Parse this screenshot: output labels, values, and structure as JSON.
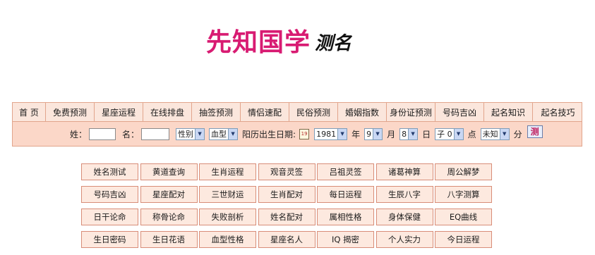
{
  "logo": {
    "main": "先知国学",
    "sub": "测名"
  },
  "nav": {
    "items": [
      {
        "label": "首 页"
      },
      {
        "label": "免费预测"
      },
      {
        "label": "星座运程"
      },
      {
        "label": "在线排盘"
      },
      {
        "label": "抽签预测"
      },
      {
        "label": "情侣速配"
      },
      {
        "label": "民俗预测"
      },
      {
        "label": "婚姻指数"
      },
      {
        "label": "身份证预测"
      },
      {
        "label": "号码吉凶"
      },
      {
        "label": "起名知识"
      },
      {
        "label": "起名技巧"
      }
    ]
  },
  "form": {
    "surname_label": "姓：",
    "name_label": "名：",
    "gender_value": "性别",
    "blood_value": "血型",
    "birth_label": "阳历出生日期:",
    "calendar_text": "19",
    "year_value": "1981",
    "year_unit": "年",
    "month_value": "9",
    "month_unit": "月",
    "day_value": "8",
    "day_unit": "日",
    "hour_value": "子 0",
    "hour_unit": "点",
    "minute_value": "未知",
    "minute_unit": "分",
    "submit_label": "测"
  },
  "grid": {
    "rows": [
      [
        "姓名测试",
        "黄道查询",
        "生肖运程",
        "观音灵签",
        "吕祖灵签",
        "诸葛神算",
        "周公解梦"
      ],
      [
        "号码吉凶",
        "星座配对",
        "三世财运",
        "生肖配对",
        "每日运程",
        "生辰八字",
        "八字测算"
      ],
      [
        "日干论命",
        "称骨论命",
        "失败剖析",
        "姓名配对",
        "属相性格",
        "身体保健",
        "EQ曲线"
      ],
      [
        "生日密码",
        "生日花语",
        "血型性格",
        "星座名人",
        "IQ 揭密",
        "个人实力",
        "今日运程"
      ]
    ]
  }
}
